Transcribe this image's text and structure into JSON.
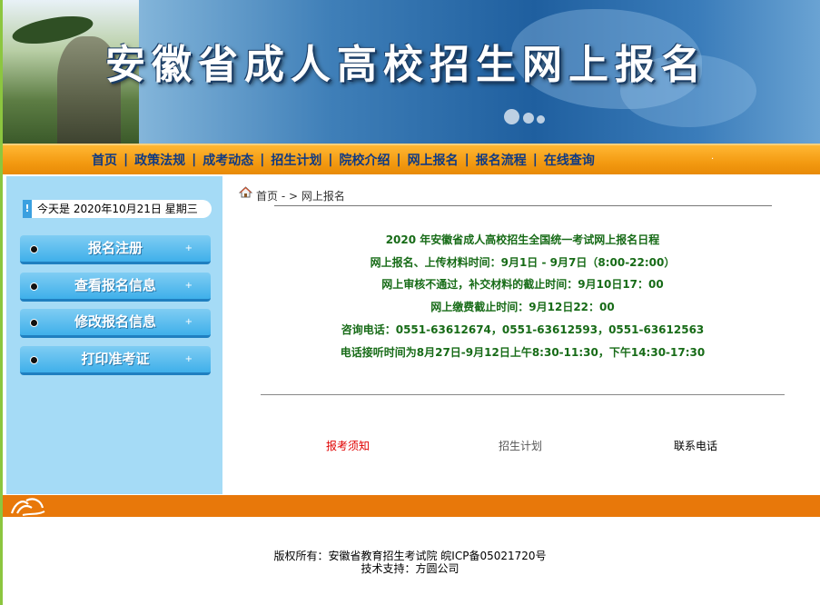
{
  "banner": {
    "title": "安徽省成人高校招生网上报名"
  },
  "nav": {
    "items": [
      "首页",
      "政策法规",
      "成考动态",
      "招生计划",
      "院校介绍",
      "网上报名",
      "报名流程",
      "在线查询"
    ],
    "separator": "|",
    "trailing_mark": "·"
  },
  "sidebar": {
    "today_label": "今天是  2020年10月21日  星期三",
    "buttons": [
      {
        "label": "报名注册",
        "plus": "+"
      },
      {
        "label": "查看报名信息",
        "plus": "+"
      },
      {
        "label": "修改报名信息",
        "plus": "+"
      },
      {
        "label": "打印准考证",
        "plus": "+"
      }
    ]
  },
  "breadcrumb": {
    "home": "首页",
    "separator": " - > ",
    "current": "网上报名"
  },
  "schedule": {
    "lines": [
      "2020 年安徽省成人高校招生全国统一考试网上报名日程",
      "网上报名、上传材料时间：9月1日 - 9月7日（8:00-22:00）",
      "网上审核不通过，补交材料的截止时间：9月10日17：00",
      "网上缴费截止时间：9月12日22：00",
      "咨询电话：0551-63612674，0551-63612593，0551-63612563",
      "电话接听时间为8月27日-9月12日上午8:30-11:30，下午14:30-17:30"
    ]
  },
  "links": {
    "notice": {
      "label": "报考须知",
      "color": "#e00000"
    },
    "plan": {
      "label": "招生计划",
      "color": "#555555"
    },
    "contact": {
      "label": "联系电话",
      "color": "#000000"
    }
  },
  "footer": {
    "copyright": "版权所有：安徽省教育招生考试院  皖ICP备05021720号",
    "support": "技术支持：方圆公司"
  },
  "colors": {
    "nav_orange": "#f39a11",
    "nav_text": "#103a82",
    "sidebar_bg": "#a5dbf6",
    "button_blue": "#3fb0ea",
    "schedule_green": "#176b17",
    "footer_orange": "#e8780a"
  }
}
